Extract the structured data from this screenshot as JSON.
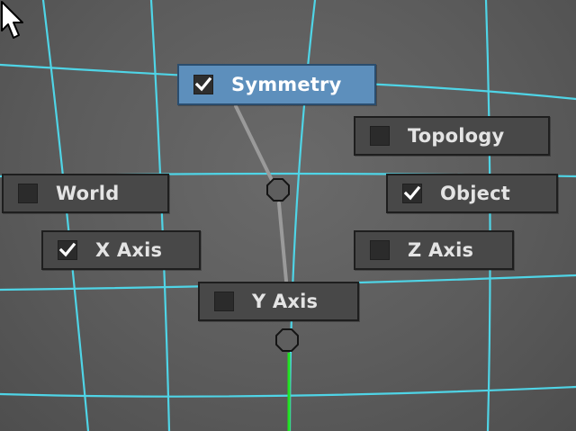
{
  "marking_menu": {
    "items": [
      {
        "id": "symmetry",
        "label": "Symmetry",
        "checked": true,
        "highlighted": true
      },
      {
        "id": "topology",
        "label": "Topology",
        "checked": false,
        "highlighted": false
      },
      {
        "id": "world",
        "label": "World",
        "checked": false,
        "highlighted": false
      },
      {
        "id": "object",
        "label": "Object",
        "checked": true,
        "highlighted": false
      },
      {
        "id": "x-axis",
        "label": "X Axis",
        "checked": true,
        "highlighted": false
      },
      {
        "id": "z-axis",
        "label": "Z Axis",
        "checked": false,
        "highlighted": false
      },
      {
        "id": "y-axis",
        "label": "Y Axis",
        "checked": false,
        "highlighted": false
      }
    ]
  },
  "icons": {
    "checkmark": "checkmark-icon",
    "cursor": "mouse-pointer-icon",
    "menu_node": "octagon-node-icon"
  },
  "colors": {
    "wireframe": "#4fd4e6",
    "highlight": "#5d8fbc",
    "axis_green": "#22e022",
    "gesture_line": "#9a9a9a"
  }
}
